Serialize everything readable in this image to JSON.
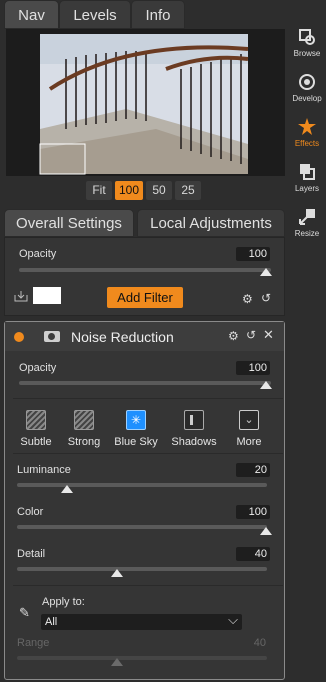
{
  "tabs": [
    {
      "label": "Nav"
    },
    {
      "label": "Levels"
    },
    {
      "label": "Info"
    }
  ],
  "zoom": {
    "options": [
      {
        "label": "Fit"
      },
      {
        "label": "100"
      },
      {
        "label": "50"
      },
      {
        "label": "25"
      }
    ],
    "selected": "100"
  },
  "subtabs": [
    {
      "label": "Overall Settings"
    },
    {
      "label": "Local Adjustments"
    }
  ],
  "overall": {
    "opacity_label": "Opacity",
    "opacity_value": "100",
    "opacity_level": 1.0,
    "add_filter_label": "Add Filter"
  },
  "filter": {
    "title": "Noise Reduction",
    "opacity_label": "Opacity",
    "opacity_value": "100",
    "opacity_level": 1.0,
    "presets": [
      {
        "label": "Subtle"
      },
      {
        "label": "Strong"
      },
      {
        "label": "Blue Sky"
      },
      {
        "label": "Shadows"
      },
      {
        "label": "More"
      }
    ],
    "sliders": [
      {
        "label": "Luminance",
        "value": "20",
        "level": 0.2
      },
      {
        "label": "Color",
        "value": "100",
        "level": 1.0
      },
      {
        "label": "Detail",
        "value": "40",
        "level": 0.4
      }
    ],
    "apply_to_label": "Apply to:",
    "apply_to_value": "All",
    "range_label": "Range",
    "range_value": "40",
    "range_level": 0.4
  },
  "sidebar": [
    {
      "label": "Browse",
      "icon": "browse-icon"
    },
    {
      "label": "Develop",
      "icon": "develop-icon"
    },
    {
      "label": "Effects",
      "icon": "effects-icon"
    },
    {
      "label": "Layers",
      "icon": "layers-icon"
    },
    {
      "label": "Resize",
      "icon": "resize-icon"
    }
  ],
  "colors": {
    "accent": "#f08a1d",
    "blue": "#1e90ff"
  }
}
